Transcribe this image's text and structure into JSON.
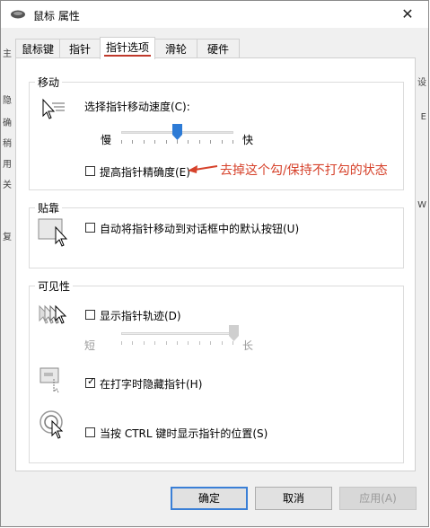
{
  "window": {
    "title": "鼠标 属性",
    "close_glyph": "✕"
  },
  "tabs": [
    {
      "label": "鼠标键",
      "active": false
    },
    {
      "label": "指针",
      "active": false
    },
    {
      "label": "指针选项",
      "active": true
    },
    {
      "label": "滑轮",
      "active": false
    },
    {
      "label": "硬件",
      "active": false
    }
  ],
  "motion": {
    "legend": "移动",
    "speed_label": "选择指针移动速度(C):",
    "slow": "慢",
    "fast": "快",
    "speed_value_percent": 50,
    "precision_label": "提高指针精确度(E)",
    "precision_checked": false
  },
  "snap": {
    "legend": "贴靠",
    "snap_label": "自动将指针移动到对话框中的默认按钮(U)",
    "snap_checked": false
  },
  "visibility": {
    "legend": "可见性",
    "trails_label": "显示指针轨迹(D)",
    "trails_checked": false,
    "short": "短",
    "long": "长",
    "trails_value_percent": 100,
    "hide_label": "在打字时隐藏指针(H)",
    "hide_checked": true,
    "ctrl_label": "当按 CTRL 键时显示指针的位置(S)",
    "ctrl_checked": false
  },
  "annotation": {
    "text": "去掉这个勾/保持不打勾的状态",
    "color": "#d6422b"
  },
  "buttons": {
    "ok": "确定",
    "cancel": "取消",
    "apply": "应用(A)"
  },
  "background_chars": {
    "left": [
      "主",
      "隐",
      "确",
      "稍",
      "用",
      "关",
      "复"
    ],
    "right": [
      "设",
      "E",
      "W"
    ]
  },
  "colors": {
    "accent": "#2d7bd6",
    "tab_underline": "#c0392b"
  },
  "icons": {
    "title": "mouse-icon",
    "check": "✓"
  }
}
